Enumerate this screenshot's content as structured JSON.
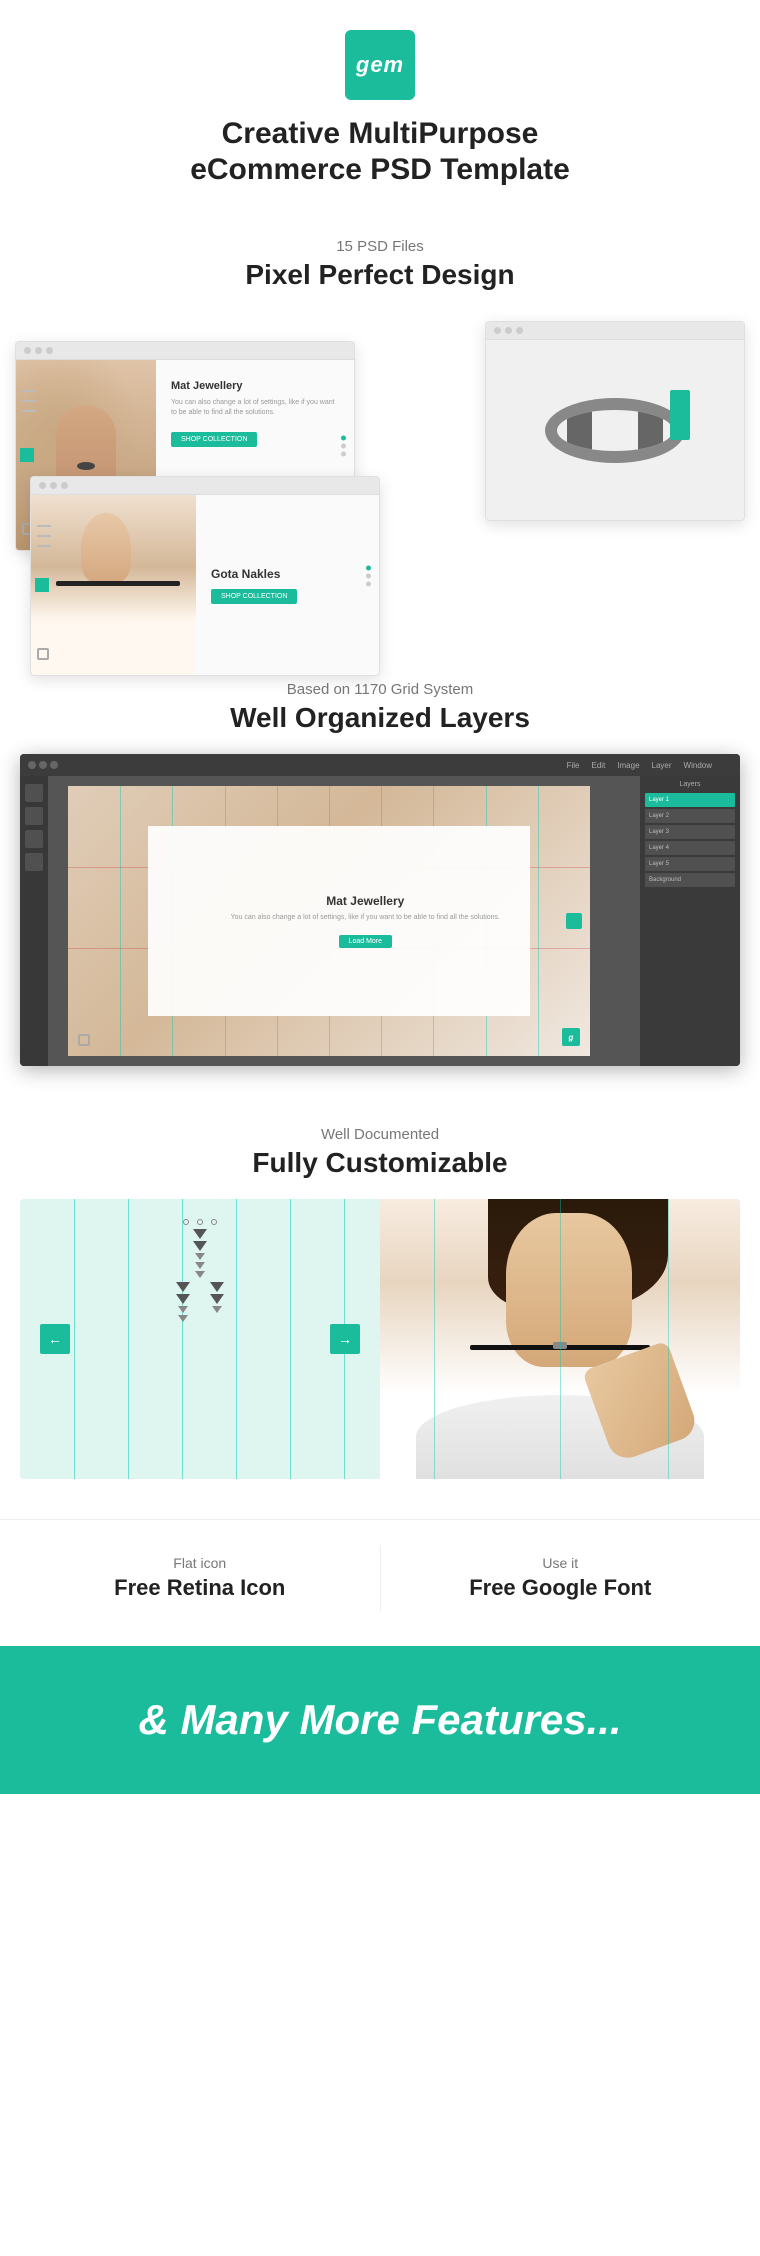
{
  "brand": {
    "logo_text": "gem",
    "logo_bg": "#1abc9c"
  },
  "header": {
    "title_line1": "Creative MultiPurpose",
    "title_line2": "eCommerce PSD Template"
  },
  "section1": {
    "subtitle": "15 PSD Files",
    "title": "Pixel Perfect Design",
    "card1_heading": "Mat Jewellery",
    "card1_desc": "You can also change a lot of settings, like if you want to be able to find all the solutions.",
    "card1_btn": "SHOP COLLECTION",
    "card3_heading": "Gota Nakles",
    "card3_btn": "SHOP COLLECTION"
  },
  "section2": {
    "subtitle": "Based on 1170 Grid System",
    "title": "Well Organized Layers",
    "ps_heading": "Mat Jewellery",
    "ps_desc": "You can also change a lot of settings, like if you want to be able to find all the solutions.",
    "ps_btn": "Load More",
    "layers": [
      "Layer 1",
      "Layer 2",
      "Layer 3",
      "Layer 4",
      "Layer 5",
      "Background"
    ]
  },
  "section3": {
    "subtitle": "Well Documented",
    "title": "Fully Customizable",
    "arrow_left": "←",
    "arrow_right": "→"
  },
  "section4": {
    "col1_subtitle": "Flat icon",
    "col1_title": "Free Retina Icon",
    "col2_subtitle": "Use it",
    "col2_title": "Free Google Font"
  },
  "section5": {
    "text": "& Many More Features..."
  }
}
